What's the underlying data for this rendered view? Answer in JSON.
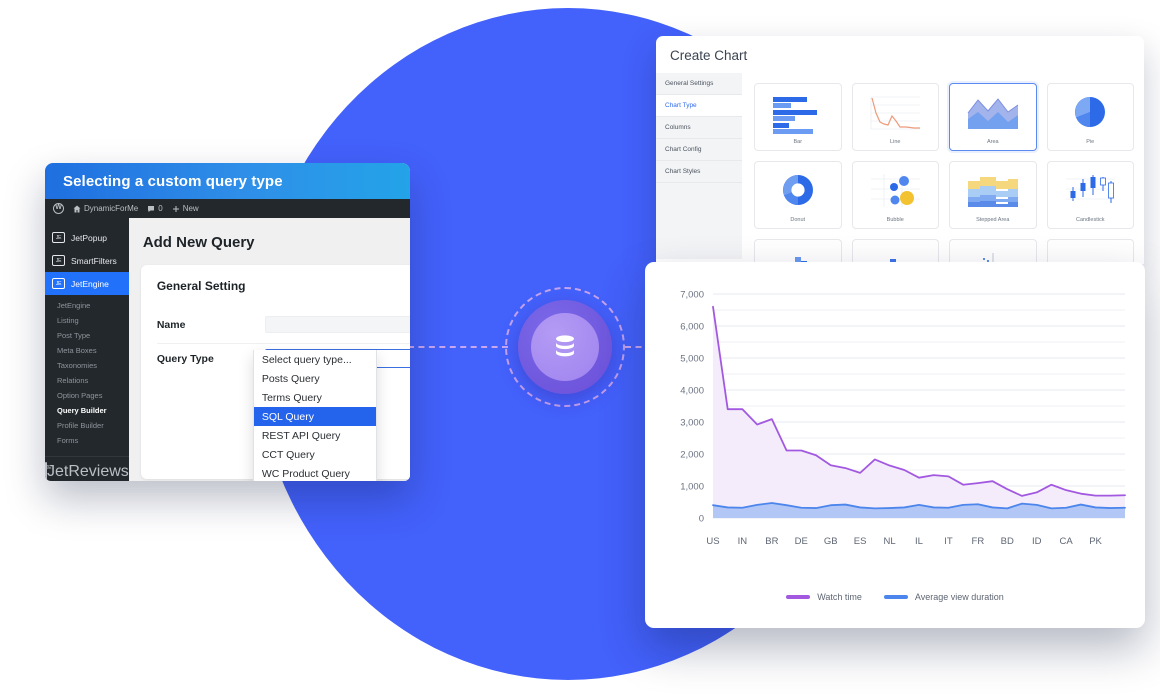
{
  "background": {
    "circle_color": "#4361fb"
  },
  "center_badge": {
    "icon": "database-icon"
  },
  "wp_window": {
    "titlebar": {
      "title": "Selecting a custom query type"
    },
    "adminbar": {
      "logo": "wordpress-icon",
      "site_name": "DynamicForMe",
      "comments_icon": "comment-icon",
      "comments_count": "0",
      "new_icon": "plus-icon",
      "new_label": "New"
    },
    "sidebar": {
      "top_items": [
        {
          "label": "JetPopup",
          "icon": "jetplugin-icon",
          "active": false
        },
        {
          "label": "SmartFilters",
          "icon": "jetplugin-icon",
          "active": false
        },
        {
          "label": "JetEngine",
          "icon": "jetplugin-icon",
          "active": true
        }
      ],
      "submenu": [
        {
          "label": "JetEngine",
          "current": false
        },
        {
          "label": "Listing",
          "current": false
        },
        {
          "label": "Post Type",
          "current": false
        },
        {
          "label": "Meta Boxes",
          "current": false
        },
        {
          "label": "Taxonomies",
          "current": false
        },
        {
          "label": "Relations",
          "current": false
        },
        {
          "label": "Option Pages",
          "current": false
        },
        {
          "label": "Query Builder",
          "current": true
        },
        {
          "label": "Profile Builder",
          "current": false
        },
        {
          "label": "Forms",
          "current": false
        }
      ],
      "bottom_items": [
        {
          "label": "JetReviews",
          "icon": "jetplugin-icon",
          "active": false
        }
      ]
    },
    "content": {
      "page_title": "Add New Query",
      "card_title": "General Setting",
      "fields": [
        {
          "label": "Name",
          "type": "text",
          "value": "",
          "placeholder": ""
        },
        {
          "label": "Query Type",
          "type": "select",
          "value": "Posts Query"
        }
      ],
      "dropdown": {
        "open": true,
        "options": [
          "Select query type...",
          "Posts Query",
          "Terms Query",
          "SQL Query",
          "REST API Query",
          "CCT Query",
          "WC Product Query"
        ],
        "selected": "SQL Query",
        "chevron_icon": "chevron-down-icon"
      }
    }
  },
  "create_chart": {
    "title": "Create Chart",
    "sidebar": [
      {
        "label": "General Settings",
        "active": false
      },
      {
        "label": "Chart Type",
        "active": true
      },
      {
        "label": "Columns",
        "active": false
      },
      {
        "label": "Chart Config",
        "active": false
      },
      {
        "label": "Chart Styles",
        "active": false
      }
    ],
    "types": [
      {
        "label": "Bar",
        "icon": "bar-chart-icon",
        "selected": false
      },
      {
        "label": "Line",
        "icon": "line-chart-icon",
        "selected": false
      },
      {
        "label": "Area",
        "icon": "area-chart-icon",
        "selected": true
      },
      {
        "label": "Pie",
        "icon": "pie-chart-icon",
        "selected": false
      },
      {
        "label": "Donut",
        "icon": "donut-chart-icon",
        "selected": false
      },
      {
        "label": "Bubble",
        "icon": "bubble-chart-icon",
        "selected": false
      },
      {
        "label": "Stepped Area",
        "icon": "stepped-area-chart-icon",
        "selected": false
      },
      {
        "label": "Candlestick",
        "icon": "candlestick-chart-icon",
        "selected": false
      },
      {
        "label": "",
        "icon": "histogram-chart-icon",
        "selected": false
      },
      {
        "label": "",
        "icon": "column-chart-icon",
        "selected": false
      },
      {
        "label": "",
        "icon": "scatter-chart-icon",
        "selected": false
      },
      {
        "label": "",
        "icon": "geo-map-chart-icon",
        "selected": false
      }
    ]
  },
  "chart_data": {
    "type": "area",
    "title": "",
    "xlabel": "",
    "ylabel": "",
    "ylim": [
      0,
      7000
    ],
    "yticks": [
      0,
      1000,
      2000,
      3000,
      4000,
      5000,
      6000,
      7000
    ],
    "ytick_labels": [
      "0",
      "1,000",
      "2,000",
      "3,000",
      "4,000",
      "5,000",
      "6,000",
      "7,000"
    ],
    "minor_gridlines": true,
    "grid": true,
    "legend_position": "bottom",
    "categories": [
      "US",
      "IN",
      "BR",
      "DE",
      "GB",
      "ES",
      "NL",
      "IL",
      "IT",
      "FR",
      "BD",
      "ID",
      "CA",
      "PK"
    ],
    "x_subdivisions": 2,
    "series": [
      {
        "name": "Watch time",
        "color": "#a259e0",
        "fill": "#f4ecfb",
        "values": [
          6600,
          3400,
          3400,
          2920,
          3090,
          2110,
          2110,
          1960,
          1650,
          1560,
          1410,
          1830,
          1640,
          1500,
          1260,
          1340,
          1300,
          1040,
          1090,
          1150,
          900,
          690,
          800,
          1040,
          870,
          760,
          700,
          700,
          710
        ]
      },
      {
        "name": "Average view duration",
        "color": "#4c86ec",
        "fill": "#aec5f6",
        "values": [
          400,
          330,
          320,
          410,
          470,
          400,
          320,
          310,
          400,
          420,
          330,
          300,
          310,
          330,
          410,
          330,
          320,
          410,
          430,
          330,
          300,
          450,
          410,
          300,
          320,
          420,
          330,
          310,
          320
        ]
      }
    ]
  }
}
